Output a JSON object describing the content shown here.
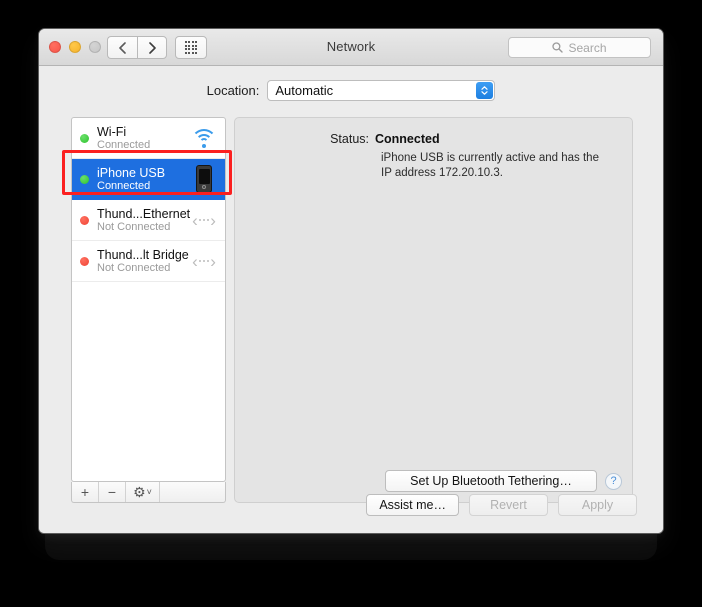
{
  "window": {
    "title": "Network",
    "traffic_lights": [
      "close",
      "minimize",
      "zoom"
    ],
    "nav": {
      "back_icon": "chevron-left-icon",
      "forward_icon": "chevron-right-icon",
      "grid_icon": "show-all-grid-icon"
    },
    "search": {
      "placeholder": "Search",
      "icon": "search-icon",
      "value": ""
    }
  },
  "location": {
    "label": "Location:",
    "selected": "Automatic",
    "options": [
      "Automatic"
    ]
  },
  "sidebar": {
    "services": [
      {
        "name": "Wi-Fi",
        "status": "Connected",
        "dot": "green",
        "icon": "wifi-icon",
        "selected": false
      },
      {
        "name": "iPhone USB",
        "status": "Connected",
        "dot": "green",
        "icon": "iphone-icon",
        "selected": true
      },
      {
        "name": "Thund...Ethernet",
        "status": "Not Connected",
        "dot": "red",
        "icon": "thunderbolt-icon",
        "selected": false
      },
      {
        "name": "Thund...lt Bridge",
        "status": "Not Connected",
        "dot": "red",
        "icon": "thunderbolt-icon",
        "selected": false
      }
    ],
    "toolbar": {
      "add_label": "+",
      "remove_label": "−",
      "gear_label": "⚙",
      "gear_chevron": "˅"
    }
  },
  "main": {
    "status_label": "Status:",
    "status_value": "Connected",
    "status_description": "iPhone USB is currently active and has the IP address 172.20.10.3.",
    "tethering_button": "Set Up Bluetooth Tethering…",
    "help_button": "?"
  },
  "footer": {
    "assist_label": "Assist me…",
    "revert_label": "Revert",
    "apply_label": "Apply"
  },
  "annotation": {
    "color": "#fb2020",
    "target": "iPhone USB"
  }
}
